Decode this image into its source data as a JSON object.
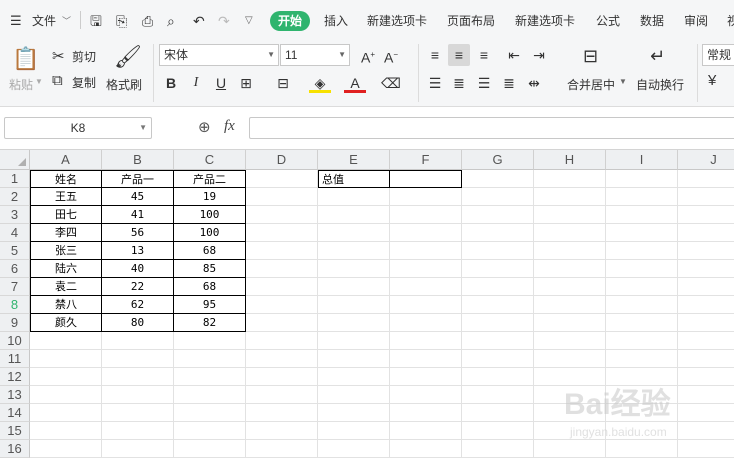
{
  "menu": {
    "file_label": "文件",
    "tabs": [
      "开始",
      "插入",
      "新建选项卡",
      "页面布局",
      "新建选项卡",
      "公式",
      "数据",
      "审阅",
      "视"
    ]
  },
  "ribbon": {
    "paste": "粘贴",
    "cut": "剪切",
    "copy": "复制",
    "format_painter": "格式刷",
    "font_name": "宋体",
    "font_size": "11",
    "merge_center": "合并居中",
    "wrap_text": "自动换行",
    "number_format": "常规",
    "currency_symbol": "¥"
  },
  "formula_bar": {
    "name_box": "K8",
    "fx_label": "fx",
    "formula": ""
  },
  "sheet": {
    "columns": [
      "A",
      "B",
      "C",
      "D",
      "E",
      "F",
      "G",
      "H",
      "I",
      "J"
    ],
    "rows": [
      "1",
      "2",
      "3",
      "4",
      "5",
      "6",
      "7",
      "8",
      "9",
      "10",
      "11",
      "12",
      "13",
      "14",
      "15",
      "16"
    ],
    "selected_row": "8",
    "table_header": [
      "姓名",
      "产品一",
      "产品二"
    ],
    "table_rows": [
      [
        "王五",
        "45",
        "19"
      ],
      [
        "田七",
        "41",
        "100"
      ],
      [
        "李四",
        "56",
        "100"
      ],
      [
        "张三",
        "13",
        "68"
      ],
      [
        "陆六",
        "40",
        "85"
      ],
      [
        "袁二",
        "22",
        "68"
      ],
      [
        "禁八",
        "62",
        "95"
      ],
      [
        "颜久",
        "80",
        "82"
      ]
    ],
    "total_label": "总值",
    "total_value": ""
  },
  "watermark": {
    "brand": "Bai经验",
    "url": "jingyan.baidu.com"
  }
}
